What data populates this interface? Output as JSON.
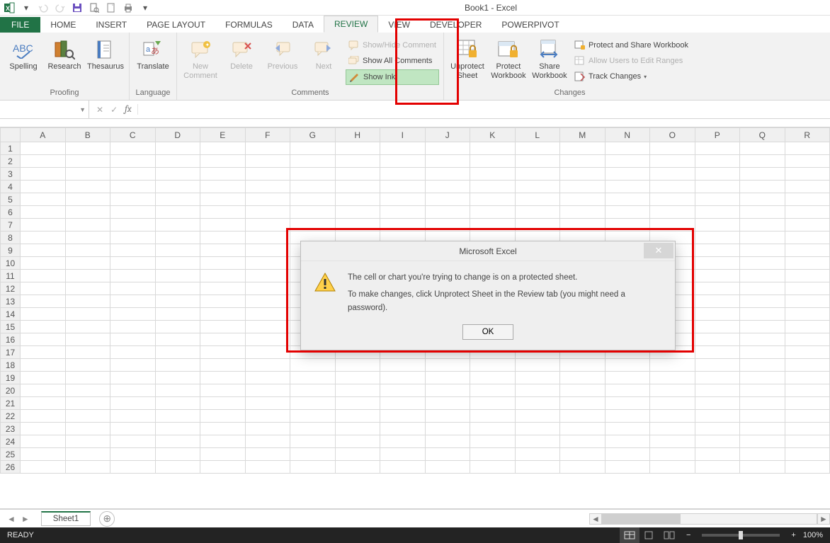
{
  "title": "Book1 - Excel",
  "qat": {
    "items": [
      "excel",
      "undo",
      "redo",
      "save",
      "print-preview",
      "new",
      "quick-print"
    ]
  },
  "tabs": [
    "FILE",
    "HOME",
    "INSERT",
    "PAGE LAYOUT",
    "FORMULAS",
    "DATA",
    "REVIEW",
    "VIEW",
    "DEVELOPER",
    "POWERPIVOT"
  ],
  "active_tab": "REVIEW",
  "ribbon": {
    "proofing": {
      "label": "Proofing",
      "spelling": "Spelling",
      "research": "Research",
      "thesaurus": "Thesaurus"
    },
    "language": {
      "label": "Language",
      "translate": "Translate"
    },
    "comments": {
      "label": "Comments",
      "new_comment": "New Comment",
      "delete": "Delete",
      "previous": "Previous",
      "next": "Next",
      "show_hide": "Show/Hide Comment",
      "show_all": "Show All Comments",
      "show_ink": "Show Ink"
    },
    "changes": {
      "label": "Changes",
      "unprotect_sheet": "Unprotect Sheet",
      "protect_workbook": "Protect Workbook",
      "share_workbook": "Share Workbook",
      "protect_share": "Protect and Share Workbook",
      "allow_users": "Allow Users to Edit Ranges",
      "track_changes": "Track Changes"
    }
  },
  "namebox": {
    "value": ""
  },
  "columns": [
    "A",
    "B",
    "C",
    "D",
    "E",
    "F",
    "G",
    "H",
    "I",
    "J",
    "K",
    "L",
    "M",
    "N",
    "O",
    "P",
    "Q",
    "R"
  ],
  "rows": [
    1,
    2,
    3,
    4,
    5,
    6,
    7,
    8,
    9,
    10,
    11,
    12,
    13,
    14,
    15,
    16,
    17,
    18,
    19,
    20,
    21,
    22,
    23,
    24,
    25,
    26
  ],
  "sheet_tab": "Sheet1",
  "status": {
    "ready": "READY",
    "zoom": "100%",
    "zoom_minus": "−",
    "zoom_plus": "+"
  },
  "dialog": {
    "title": "Microsoft Excel",
    "line1": "The cell or chart you're trying to change is on a protected sheet.",
    "line2": "To make changes, click Unprotect Sheet in the Review tab (you might need a password).",
    "ok": "OK"
  }
}
